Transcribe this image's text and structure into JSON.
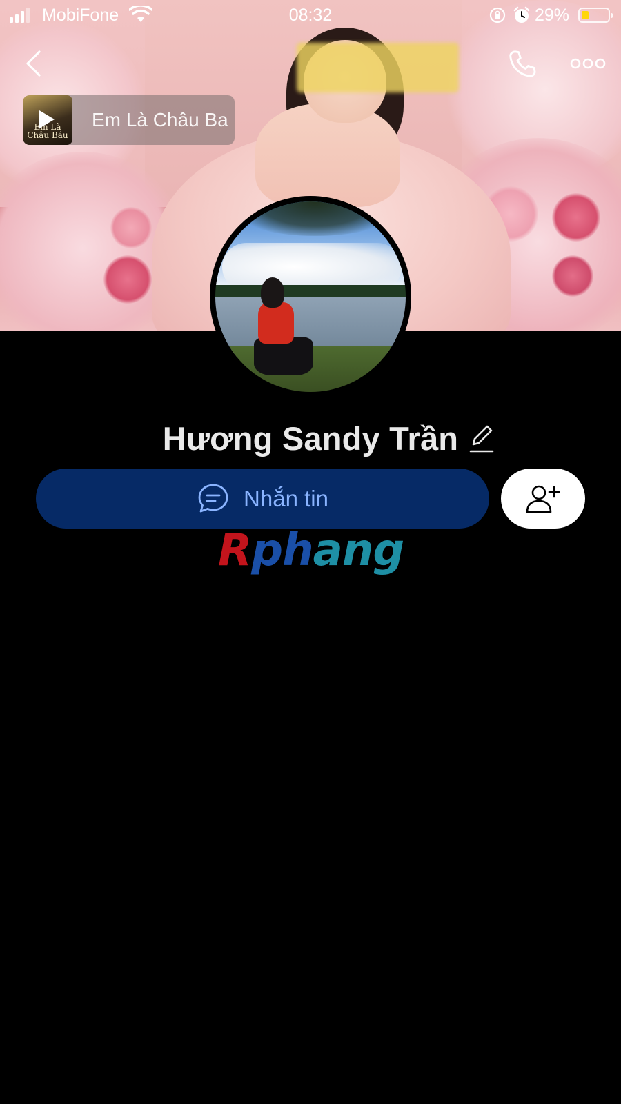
{
  "status_bar": {
    "carrier": "MobiFone",
    "time": "08:32",
    "battery_percent": "29%",
    "battery_level": 0.29,
    "icons": [
      "signal-icon",
      "wifi-icon",
      "orientation-lock-icon",
      "alarm-icon",
      "battery-icon"
    ]
  },
  "nav": {
    "back_icon": "chevron-left-icon",
    "call_icon": "phone-icon",
    "more_icon": "more-dots-icon"
  },
  "music": {
    "song_title": "Em Là Châu Ba",
    "album_text": "Em Là Châu Báu",
    "play_icon": "play-icon"
  },
  "profile": {
    "name": "Hương Sandy Trần",
    "edit_icon": "pencil-icon"
  },
  "actions": {
    "message_label": "Nhắn tin",
    "message_icon": "chat-bubble-icon",
    "add_friend_icon": "add-user-icon"
  },
  "watermark": {
    "part1": "R",
    "part2": "ph",
    "part3": "ang"
  },
  "colors": {
    "background": "#000000",
    "message_button_bg": "#062a66",
    "message_button_text": "#8ab4ff",
    "add_button_bg": "#ffffff",
    "battery_fill": "#ffd60a"
  }
}
